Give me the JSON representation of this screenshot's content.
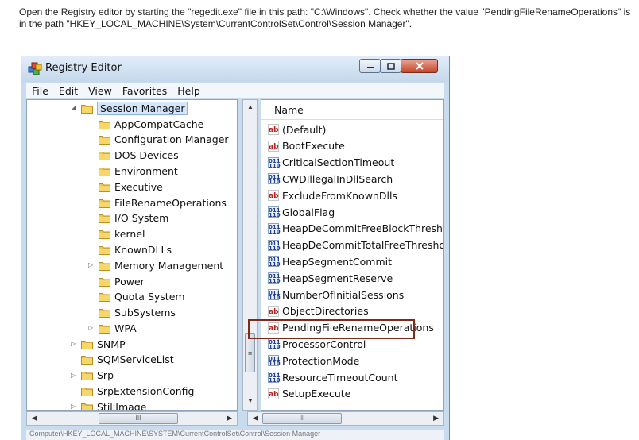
{
  "instruction": "Open the Registry editor by starting the \"regedit.exe\" file in this path: \"C:\\Windows\". Check whether the value \"PendingFileRenameOperations\" is in the path \"HKEY_LOCAL_MACHINE\\System\\CurrentControlSet\\Control\\Session Manager\".",
  "window": {
    "title": "Registry Editor"
  },
  "menu": [
    "File",
    "Edit",
    "View",
    "Favorites",
    "Help"
  ],
  "tree": {
    "selected": "Session Manager",
    "children": [
      "AppCompatCache",
      "Configuration Manager",
      "DOS Devices",
      "Environment",
      "Executive",
      "FileRenameOperations",
      "I/O System",
      "kernel",
      "KnownDLLs",
      "Memory Management",
      "Power",
      "Quota System",
      "SubSystems",
      "WPA"
    ],
    "siblings": [
      "SNMP",
      "SQMServiceList",
      "Srp",
      "SrpExtensionConfig",
      "StillImage"
    ]
  },
  "list": {
    "column": "Name",
    "items": [
      {
        "name": "(Default)",
        "type": "ab"
      },
      {
        "name": "BootExecute",
        "type": "ab"
      },
      {
        "name": "CriticalSectionTimeout",
        "type": "num"
      },
      {
        "name": "CWDIllegalInDllSearch",
        "type": "num"
      },
      {
        "name": "ExcludeFromKnownDlls",
        "type": "ab"
      },
      {
        "name": "GlobalFlag",
        "type": "num"
      },
      {
        "name": "HeapDeCommitFreeBlockThreshold",
        "type": "num"
      },
      {
        "name": "HeapDeCommitTotalFreeThreshold",
        "type": "num"
      },
      {
        "name": "HeapSegmentCommit",
        "type": "num"
      },
      {
        "name": "HeapSegmentReserve",
        "type": "num"
      },
      {
        "name": "NumberOfInitialSessions",
        "type": "num"
      },
      {
        "name": "ObjectDirectories",
        "type": "ab"
      },
      {
        "name": "PendingFileRenameOperations",
        "type": "ab"
      },
      {
        "name": "ProcessorControl",
        "type": "num"
      },
      {
        "name": "ProtectionMode",
        "type": "num"
      },
      {
        "name": "ResourceTimeoutCount",
        "type": "num"
      },
      {
        "name": "SetupExecute",
        "type": "ab"
      }
    ],
    "highlighted": "PendingFileRenameOperations"
  },
  "icons": {
    "ab": "ab",
    "num": "011 110"
  },
  "status": "Computer\\HKEY_LOCAL_MACHINE\\SYSTEM\\CurrentControlSet\\Control\\Session Manager"
}
